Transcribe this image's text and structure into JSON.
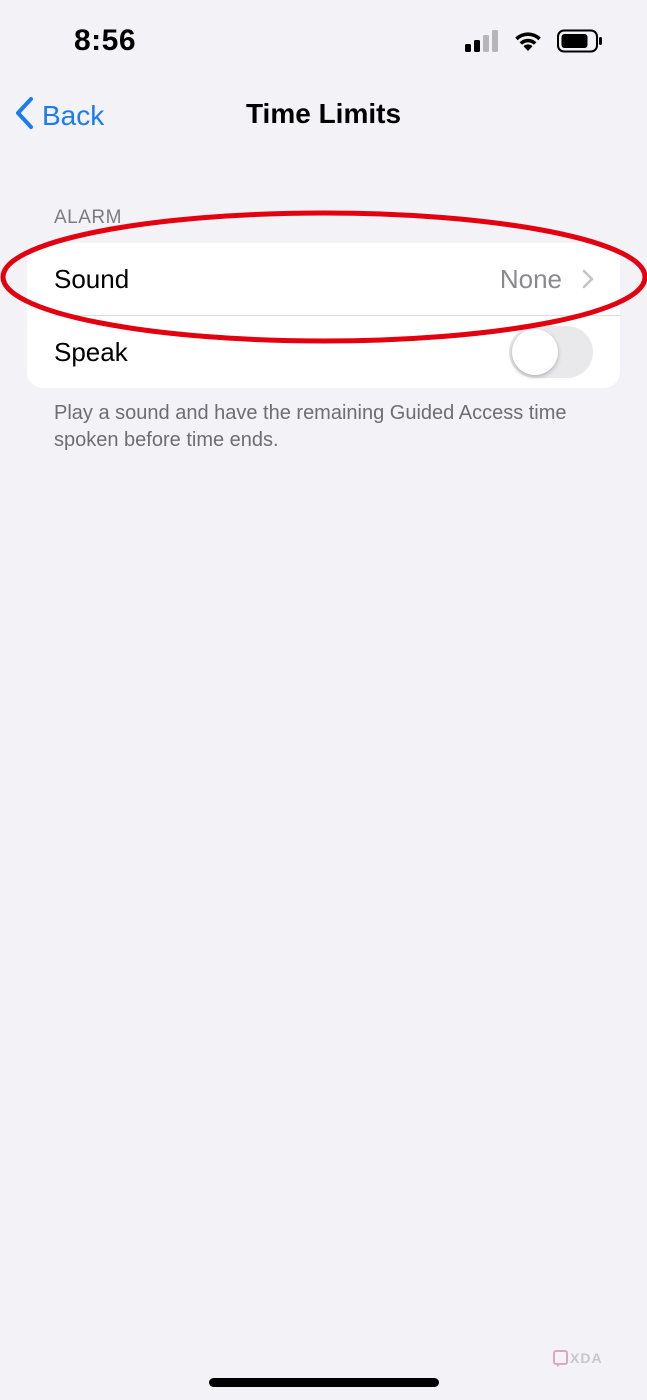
{
  "status_bar": {
    "time": "8:56",
    "icons": [
      "cellular-signal-icon",
      "wifi-icon",
      "battery-icon"
    ]
  },
  "nav": {
    "back_label": "Back",
    "title": "Time Limits"
  },
  "section": {
    "header": "ALARM",
    "rows": [
      {
        "label": "Sound",
        "value": "None",
        "control": "disclosure"
      },
      {
        "label": "Speak",
        "control": "toggle",
        "on": false
      }
    ],
    "footer": "Play a sound and have the remaining Guided Access time spoken before time ends."
  },
  "annotation": {
    "shape": "ellipse",
    "target": "Sound row",
    "color": "#e3000f"
  },
  "watermark": {
    "text": "XDA"
  },
  "colors": {
    "accent": "#1a7cf0",
    "background": "#f2f2f7",
    "secondary_text": "#8a8a8e"
  }
}
